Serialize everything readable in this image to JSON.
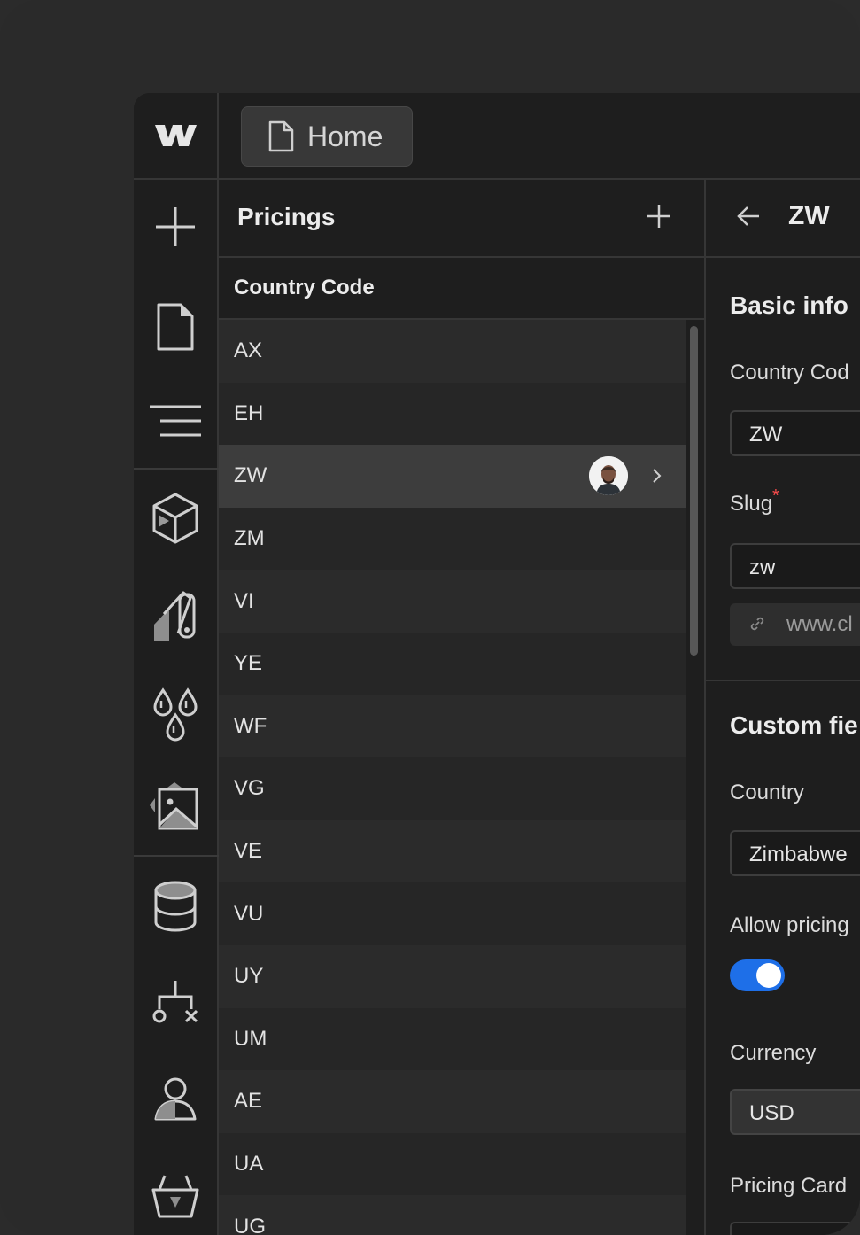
{
  "topbar": {
    "home_label": "Home"
  },
  "list": {
    "title": "Pricings",
    "column_header": "Country Code",
    "rows": [
      "AX",
      "EH",
      "ZW",
      "ZM",
      "VI",
      "YE",
      "WF",
      "VG",
      "VE",
      "VU",
      "UY",
      "UM",
      "AE",
      "UA",
      "UG"
    ]
  },
  "detail": {
    "title": "ZW",
    "basic_info": "Basic info",
    "country_code_label": "Country Cod",
    "country_code_value": "ZW",
    "slug_label": "Slug",
    "slug_required": "*",
    "slug_value": "zw",
    "url_preview": "www.cl",
    "custom_fields": "Custom fie",
    "country_label": "Country",
    "country_value": "Zimbabwe",
    "allow_pricing_label": "Allow pricing",
    "allow_pricing_on": true,
    "currency_label": "Currency",
    "currency_value": "USD",
    "pricing_card_label": "Pricing Card"
  },
  "colors": {
    "accent": "#1e6fe8",
    "required": "#ff4d4d"
  }
}
